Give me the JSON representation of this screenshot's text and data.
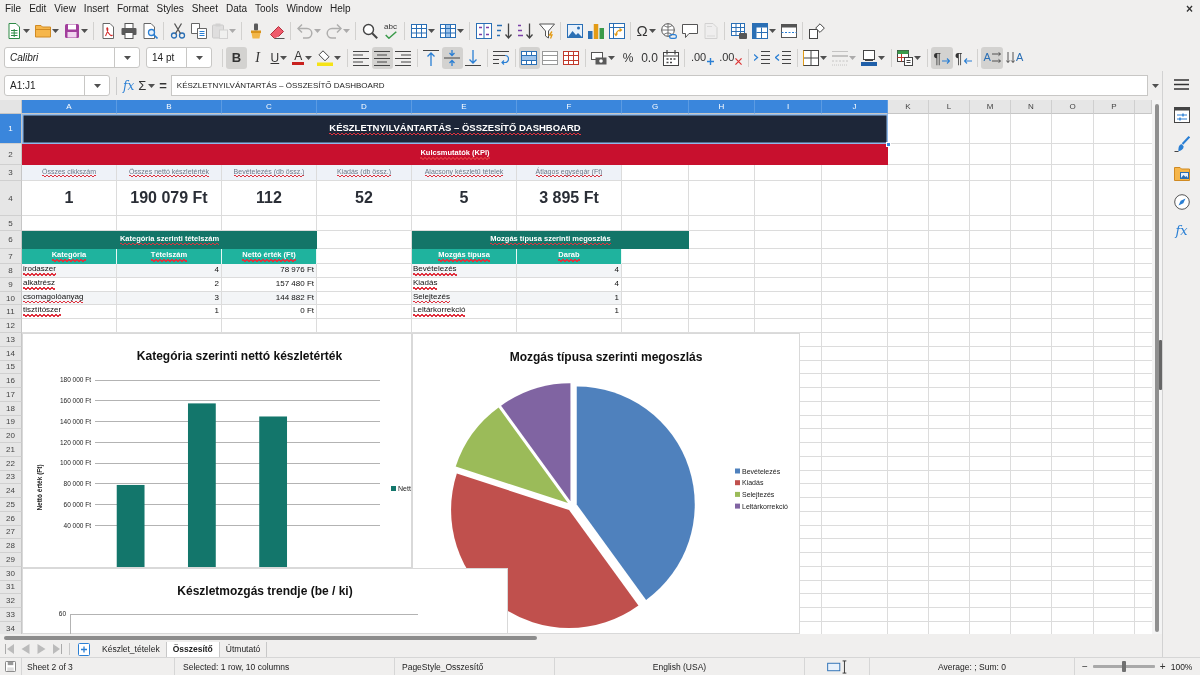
{
  "menu_bar": {
    "items": [
      "File",
      "Edit",
      "View",
      "Insert",
      "Format",
      "Styles",
      "Sheet",
      "Data",
      "Tools",
      "Window",
      "Help"
    ],
    "close": "×"
  },
  "standard_toolbar": [
    {
      "disabled": false
    },
    {
      "disabled": false
    },
    {
      "disabled": false
    },
    {
      "disabled": false
    },
    {
      "disabled": false
    },
    {
      "disabled": false
    },
    {
      "disabled": false
    },
    {
      "disabled": false
    },
    {
      "disabled": true
    },
    {
      "disabled": false
    },
    {
      "disabled": false
    },
    {
      "disabled": true
    },
    {
      "disabled": true
    },
    {
      "disabled": false
    },
    {
      "glyph": "abc",
      "disabled": false
    },
    {
      "disabled": false
    },
    {
      "disabled": false
    },
    {
      "disabled": false
    },
    {
      "disabled": false
    },
    {
      "disabled": false
    },
    {
      "disabled": false
    },
    {
      "disabled": false
    },
    {
      "disabled": false
    },
    {
      "disabled": false
    },
    {
      "glyph": "Ω",
      "disabled": false
    },
    {
      "disabled": false
    },
    {
      "disabled": false
    },
    {
      "disabled": true
    },
    {
      "disabled": false
    },
    {
      "disabled": false
    },
    {
      "disabled": false
    },
    {
      "disabled": false
    }
  ],
  "formatting_toolbar": {
    "font_name": "Calibri",
    "font_size": "14 pt",
    "buttons": [
      {
        "glyph": "B",
        "pressed": true,
        "disabled": false
      },
      {
        "glyph": "I",
        "pressed": false,
        "disabled": false
      },
      {
        "glyph": "U",
        "pressed": false,
        "disabled": false
      },
      {
        "glyph": "A",
        "pressed": false,
        "disabled": false
      },
      {
        "pressed": false,
        "disabled": false
      },
      {
        "pressed": false,
        "disabled": false
      },
      {
        "pressed": true,
        "disabled": false
      },
      {
        "pressed": false,
        "disabled": false
      },
      {
        "pressed": false,
        "disabled": false
      },
      {
        "pressed": true,
        "disabled": false
      },
      {
        "pressed": false,
        "disabled": false
      },
      {
        "pressed": false,
        "disabled": false
      },
      {
        "pressed": true,
        "disabled": false
      },
      {
        "pressed": false,
        "disabled": false
      },
      {
        "pressed": false,
        "disabled": false
      },
      {
        "pressed": false,
        "disabled": false
      },
      {
        "glyph": "%",
        "pressed": false,
        "disabled": false
      },
      {
        "glyph": "0.0",
        "pressed": false,
        "disabled": false
      },
      {
        "pressed": false,
        "disabled": false
      },
      {
        "glyph": ".00",
        "pressed": false,
        "disabled": false
      },
      {
        "glyph": ".00",
        "pressed": false,
        "disabled": false
      },
      {
        "pressed": false,
        "disabled": false
      },
      {
        "pressed": false,
        "disabled": false
      },
      {
        "pressed": false,
        "disabled": false
      },
      {
        "pressed": false,
        "disabled": true
      },
      {
        "pressed": false,
        "disabled": false
      },
      {
        "pressed": false,
        "disabled": false
      },
      {
        "glyph": "¶",
        "pressed": true,
        "disabled": false
      },
      {
        "glyph": "¶",
        "pressed": false,
        "disabled": false
      },
      {
        "glyph": "A",
        "pressed": true,
        "disabled": false
      },
      {
        "glyph": "A",
        "pressed": false,
        "disabled": false
      }
    ]
  },
  "formula_bar": {
    "name_box": "A1:J1",
    "function_wizard": "fx",
    "sum": "Σ",
    "equals": "=",
    "content": "KÉSZLETNYILVÁNTARTÁS – ÖSSZESÍTŐ DASHBOARD"
  },
  "sheet": {
    "columns": [
      {
        "label": "A",
        "selected": true
      },
      {
        "label": "B",
        "selected": true
      },
      {
        "label": "C",
        "selected": true
      },
      {
        "label": "D",
        "selected": true
      },
      {
        "label": "E",
        "selected": true
      },
      {
        "label": "F",
        "selected": true
      },
      {
        "label": "G",
        "selected": true
      },
      {
        "label": "H",
        "selected": true
      },
      {
        "label": "I",
        "selected": true
      },
      {
        "label": "J",
        "selected": true
      },
      {
        "label": "K",
        "selected": false
      },
      {
        "label": "L",
        "selected": false
      },
      {
        "label": "M",
        "selected": false
      },
      {
        "label": "N",
        "selected": false
      },
      {
        "label": "O",
        "selected": false
      },
      {
        "label": "P",
        "selected": false
      }
    ],
    "rows": [
      {
        "label": "1",
        "selected": true
      },
      {
        "label": "2",
        "selected": false
      },
      {
        "label": "3",
        "selected": false
      },
      {
        "label": "4",
        "selected": false
      },
      {
        "label": "5",
        "selected": false
      },
      {
        "label": "6",
        "selected": false
      },
      {
        "label": "7",
        "selected": false
      },
      {
        "label": "8",
        "selected": false
      },
      {
        "label": "9",
        "selected": false
      },
      {
        "label": "10",
        "selected": false
      },
      {
        "label": "11",
        "selected": false
      },
      {
        "label": "12",
        "selected": false
      },
      {
        "label": "13",
        "selected": false
      },
      {
        "label": "14",
        "selected": false
      },
      {
        "label": "15",
        "selected": false
      },
      {
        "label": "16",
        "selected": false
      },
      {
        "label": "17",
        "selected": false
      },
      {
        "label": "18",
        "selected": false
      },
      {
        "label": "19",
        "selected": false
      },
      {
        "label": "20",
        "selected": false
      },
      {
        "label": "21",
        "selected": false
      },
      {
        "label": "22",
        "selected": false
      },
      {
        "label": "23",
        "selected": false
      },
      {
        "label": "24",
        "selected": false
      },
      {
        "label": "25",
        "selected": false
      },
      {
        "label": "26",
        "selected": false
      },
      {
        "label": "27",
        "selected": false
      },
      {
        "label": "28",
        "selected": false
      },
      {
        "label": "29",
        "selected": false
      },
      {
        "label": "30",
        "selected": false
      },
      {
        "label": "31",
        "selected": false
      },
      {
        "label": "32",
        "selected": false
      },
      {
        "label": "33",
        "selected": false
      },
      {
        "label": "34",
        "selected": false
      }
    ],
    "title": {
      "text": "KÉSZLETNYILVÁNTARTÁS – ÖSSZESÍTŐ DASHBOARD",
      "selected": true,
      "spell_error": true
    },
    "kpi_heading": {
      "text": "Kulcsmutatók (KPI)",
      "spell_error": true
    },
    "kpis": [
      {
        "label": "Összes cikkszám",
        "value": "1",
        "spell_error": true
      },
      {
        "label": "Összes nettó készletérték",
        "value": "190 079 Ft",
        "spell_error": true
      },
      {
        "label": "Bevételezés (db össz.)",
        "value": "112",
        "spell_error": true
      },
      {
        "label": "Kiadás (db össz.)",
        "value": "52",
        "spell_error": true
      },
      {
        "label": "Alacsony készletű tételek",
        "value": "5",
        "spell_error": true
      },
      {
        "label": "Átlagos egységár (Ft)",
        "value": "3 895 Ft",
        "spell_error": true
      }
    ],
    "tables": [
      {
        "title": {
          "text": "Kategória szerinti tételszám",
          "spell_error": true
        },
        "header": [
          {
            "text": "Kategória",
            "spell_error": true
          },
          {
            "text": "Tételszám",
            "spell_error": true
          },
          {
            "text": "Nettó érték (Ft)",
            "spell_error": true
          }
        ],
        "rows": [
          [
            {
              "text": "irodaszer",
              "spell_error": true
            },
            {
              "text": "4",
              "spell_error": false
            },
            {
              "text": "78 976 Ft",
              "spell_error": false
            }
          ],
          [
            {
              "text": "alkatrész",
              "spell_error": true
            },
            {
              "text": "2",
              "spell_error": false
            },
            {
              "text": "157 480 Ft",
              "spell_error": false
            }
          ],
          [
            {
              "text": "csomagolóanyag",
              "spell_error": true
            },
            {
              "text": "3",
              "spell_error": false
            },
            {
              "text": "144 882 Ft",
              "spell_error": false
            }
          ],
          [
            {
              "text": "tisztítószer",
              "spell_error": true
            },
            {
              "text": "1",
              "spell_error": false
            },
            {
              "text": "0 Ft",
              "spell_error": false
            }
          ]
        ]
      },
      {
        "title": {
          "text": "Mozgás típusa szerinti megoszlás",
          "spell_error": true
        },
        "header": [
          {
            "text": "Mozgás típusa",
            "spell_error": true
          },
          {
            "text": "Darab",
            "spell_error": true
          }
        ],
        "rows": [
          [
            {
              "text": "Bevételezés",
              "spell_error": true
            },
            {
              "text": "4",
              "spell_error": false
            }
          ],
          [
            {
              "text": "Kiadás",
              "spell_error": true
            },
            {
              "text": "4",
              "spell_error": false
            }
          ],
          [
            {
              "text": "Selejtezés",
              "spell_error": true
            },
            {
              "text": "1",
              "spell_error": false
            }
          ],
          [
            {
              "text": "Leltárkorrekció",
              "spell_error": true
            },
            {
              "text": "1",
              "spell_error": false
            }
          ]
        ]
      }
    ],
    "charts": [
      {
        "chart_data": {
          "type": "bar",
          "title": "Kategória szerinti nettó készletérték",
          "ylabel": "Nettó érték (Ft)",
          "ylim": [
            0,
            180000
          ],
          "yticks": [
            {
              "value": 40000,
              "label": "40 000 Ft"
            },
            {
              "value": 60000,
              "label": "60 000 Ft"
            },
            {
              "value": 80000,
              "label": "80 000 Ft"
            },
            {
              "value": 100000,
              "label": "100 000 Ft"
            },
            {
              "value": 120000,
              "label": "120 000 Ft"
            },
            {
              "value": 140000,
              "label": "140 000 Ft"
            },
            {
              "value": 160000,
              "label": "160 000 Ft"
            },
            {
              "value": 180000,
              "label": "180 000 Ft"
            }
          ],
          "grid": true,
          "legend": "right",
          "series": [
            {
              "name": "Nett",
              "color": "#13766b",
              "values": [
                78976,
                157480,
                144882,
                0
              ]
            }
          ]
        }
      },
      {
        "chart_data": {
          "type": "pie",
          "title": "Mozgás típusa szerinti megoszlás",
          "categories": [
            "Bevételezés",
            "Kiadás",
            "Selejtezés",
            "Leltárkorrekció"
          ],
          "values": [
            40,
            40,
            10,
            10
          ],
          "colors": [
            "#4f81bd",
            "#c0504d",
            "#9bbb59",
            "#8064a2"
          ],
          "legend": "right"
        }
      },
      {
        "title": "Készletmozgás trendje (be / ki)",
        "axis_label": "60"
      }
    ]
  },
  "sidebar": {
    "functions": "fx"
  },
  "sheet_tabs": [
    {
      "label": "Készlet_tételek",
      "selected": false
    },
    {
      "label": "Összesítő",
      "selected": true
    },
    {
      "label": "Útmutató",
      "selected": false
    }
  ],
  "status_bar": {
    "sheet_position": "Sheet 2 of 3",
    "selection": "Selected: 1 row, 10 columns",
    "page_style": "PageStyle_Osszesítő",
    "language": "English (USA)",
    "summary": "Average: ; Sum: 0",
    "zoom_out": "−",
    "zoom": {
      "level": 0.5
    },
    "zoom_in": "+",
    "zoom_percent": "100%"
  }
}
